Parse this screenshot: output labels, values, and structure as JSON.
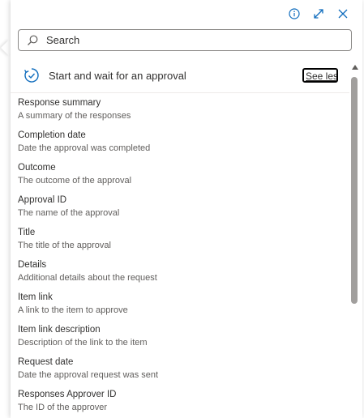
{
  "background": {
    "partial_title": "Start and wait for an approval"
  },
  "toolbar": {
    "info_icon": "info-icon",
    "expand_icon": "expand-icon",
    "close_icon": "close-icon"
  },
  "search": {
    "placeholder": "Search",
    "value": ""
  },
  "action": {
    "title": "Start and wait for an approval",
    "toggle_label": "See less"
  },
  "items": [
    {
      "title": "Response summary",
      "description": "A summary of the responses"
    },
    {
      "title": "Completion date",
      "description": "Date the approval was completed"
    },
    {
      "title": "Outcome",
      "description": "The outcome of the approval"
    },
    {
      "title": "Approval ID",
      "description": "The name of the approval"
    },
    {
      "title": "Title",
      "description": "The title of the approval"
    },
    {
      "title": "Details",
      "description": "Additional details about the request"
    },
    {
      "title": "Item link",
      "description": "A link to the item to approve"
    },
    {
      "title": "Item link description",
      "description": "Description of the link to the item"
    },
    {
      "title": "Request date",
      "description": "Date the approval request was sent"
    },
    {
      "title": "Responses Approver ID",
      "description": "The ID of the approver"
    }
  ],
  "colors": {
    "accent": "#0f6cbd",
    "text": "#323130",
    "subtext": "#605e5c",
    "scrollbar": "#a19f9d"
  }
}
